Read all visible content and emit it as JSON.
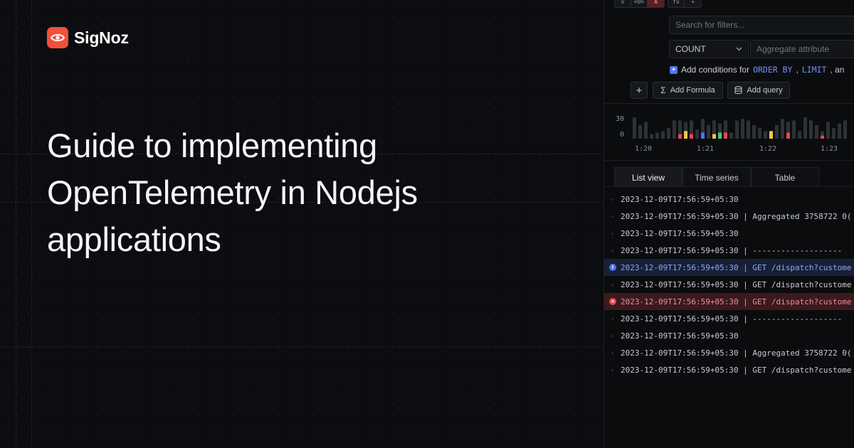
{
  "brand": {
    "name": "SigNoz",
    "accent": "#f24f3c"
  },
  "headline": [
    "Guide to implementing",
    "OpenTelemetry in Nodejs",
    "applications"
  ],
  "query_builder": {
    "toolbar": [
      "v",
      "<0>",
      "A",
      "fx",
      "+"
    ],
    "search_placeholder": "Search for filters...",
    "aggregate_operator": "COUNT",
    "aggregate_placeholder": "Aggregate attribute",
    "conditions_prefix": "Add conditions for",
    "conditions_kw1": "ORDER BY",
    "conditions_sep": ",",
    "conditions_kw2": "LIMIT",
    "conditions_suffix": ", an",
    "add_formula_label": "Add Formula",
    "add_query_label": "Add query"
  },
  "chart_data": {
    "type": "bar",
    "y_ticks": [
      "30",
      "0"
    ],
    "x_ticks": [
      "1:20",
      "1:21",
      "1:22",
      "1:23"
    ],
    "ylim": [
      0,
      30
    ],
    "values": [
      28,
      18,
      22,
      6,
      8,
      10,
      14,
      24,
      24,
      22,
      24,
      12,
      26,
      18,
      24,
      20,
      24,
      8,
      24,
      26,
      24,
      18,
      14,
      10,
      8,
      18,
      26,
      22,
      24,
      10,
      28,
      24,
      18,
      10,
      22,
      14,
      20,
      24
    ],
    "highlights": [
      {
        "index": 8,
        "value": 6,
        "color": "#e5484d"
      },
      {
        "index": 9,
        "value": 10,
        "color": "#f5c542"
      },
      {
        "index": 10,
        "value": 6,
        "color": "#e5484d"
      },
      {
        "index": 12,
        "value": 8,
        "color": "#4e74f8"
      },
      {
        "index": 14,
        "value": 6,
        "color": "#f5c542"
      },
      {
        "index": 15,
        "value": 8,
        "color": "#3ccf72"
      },
      {
        "index": 16,
        "value": 8,
        "color": "#e5484d"
      },
      {
        "index": 24,
        "value": 10,
        "color": "#f5c542"
      },
      {
        "index": 27,
        "value": 8,
        "color": "#e5484d"
      },
      {
        "index": 33,
        "value": 4,
        "color": "#e5484d"
      }
    ]
  },
  "tabs": [
    "List view",
    "Time series",
    "Table"
  ],
  "logs": [
    {
      "text": "2023-12-09T17:56:59+05:30",
      "level": "none"
    },
    {
      "text": "2023-12-09T17:56:59+05:30 | Aggregated 3758722 0(",
      "level": "none"
    },
    {
      "text": "2023-12-09T17:56:59+05:30",
      "level": "none"
    },
    {
      "text": "2023-12-09T17:56:59+05:30 | -------------------",
      "level": "none"
    },
    {
      "text": "2023-12-09T17:56:59+05:30 | GET /dispatch?custome",
      "level": "info"
    },
    {
      "text": "2023-12-09T17:56:59+05:30 | GET /dispatch?custome",
      "level": "none"
    },
    {
      "text": "2023-12-09T17:56:59+05:30 | GET /dispatch?custome",
      "level": "error"
    },
    {
      "text": "2023-12-09T17:56:59+05:30 | -------------------",
      "level": "none"
    },
    {
      "text": "2023-12-09T17:56:59+05:30",
      "level": "none"
    },
    {
      "text": "2023-12-09T17:56:59+05:30 | Aggregated 3758722 0(",
      "level": "none"
    },
    {
      "text": "2023-12-09T17:56:59+05:30 | GET /dispatch?custome",
      "level": "none"
    }
  ]
}
